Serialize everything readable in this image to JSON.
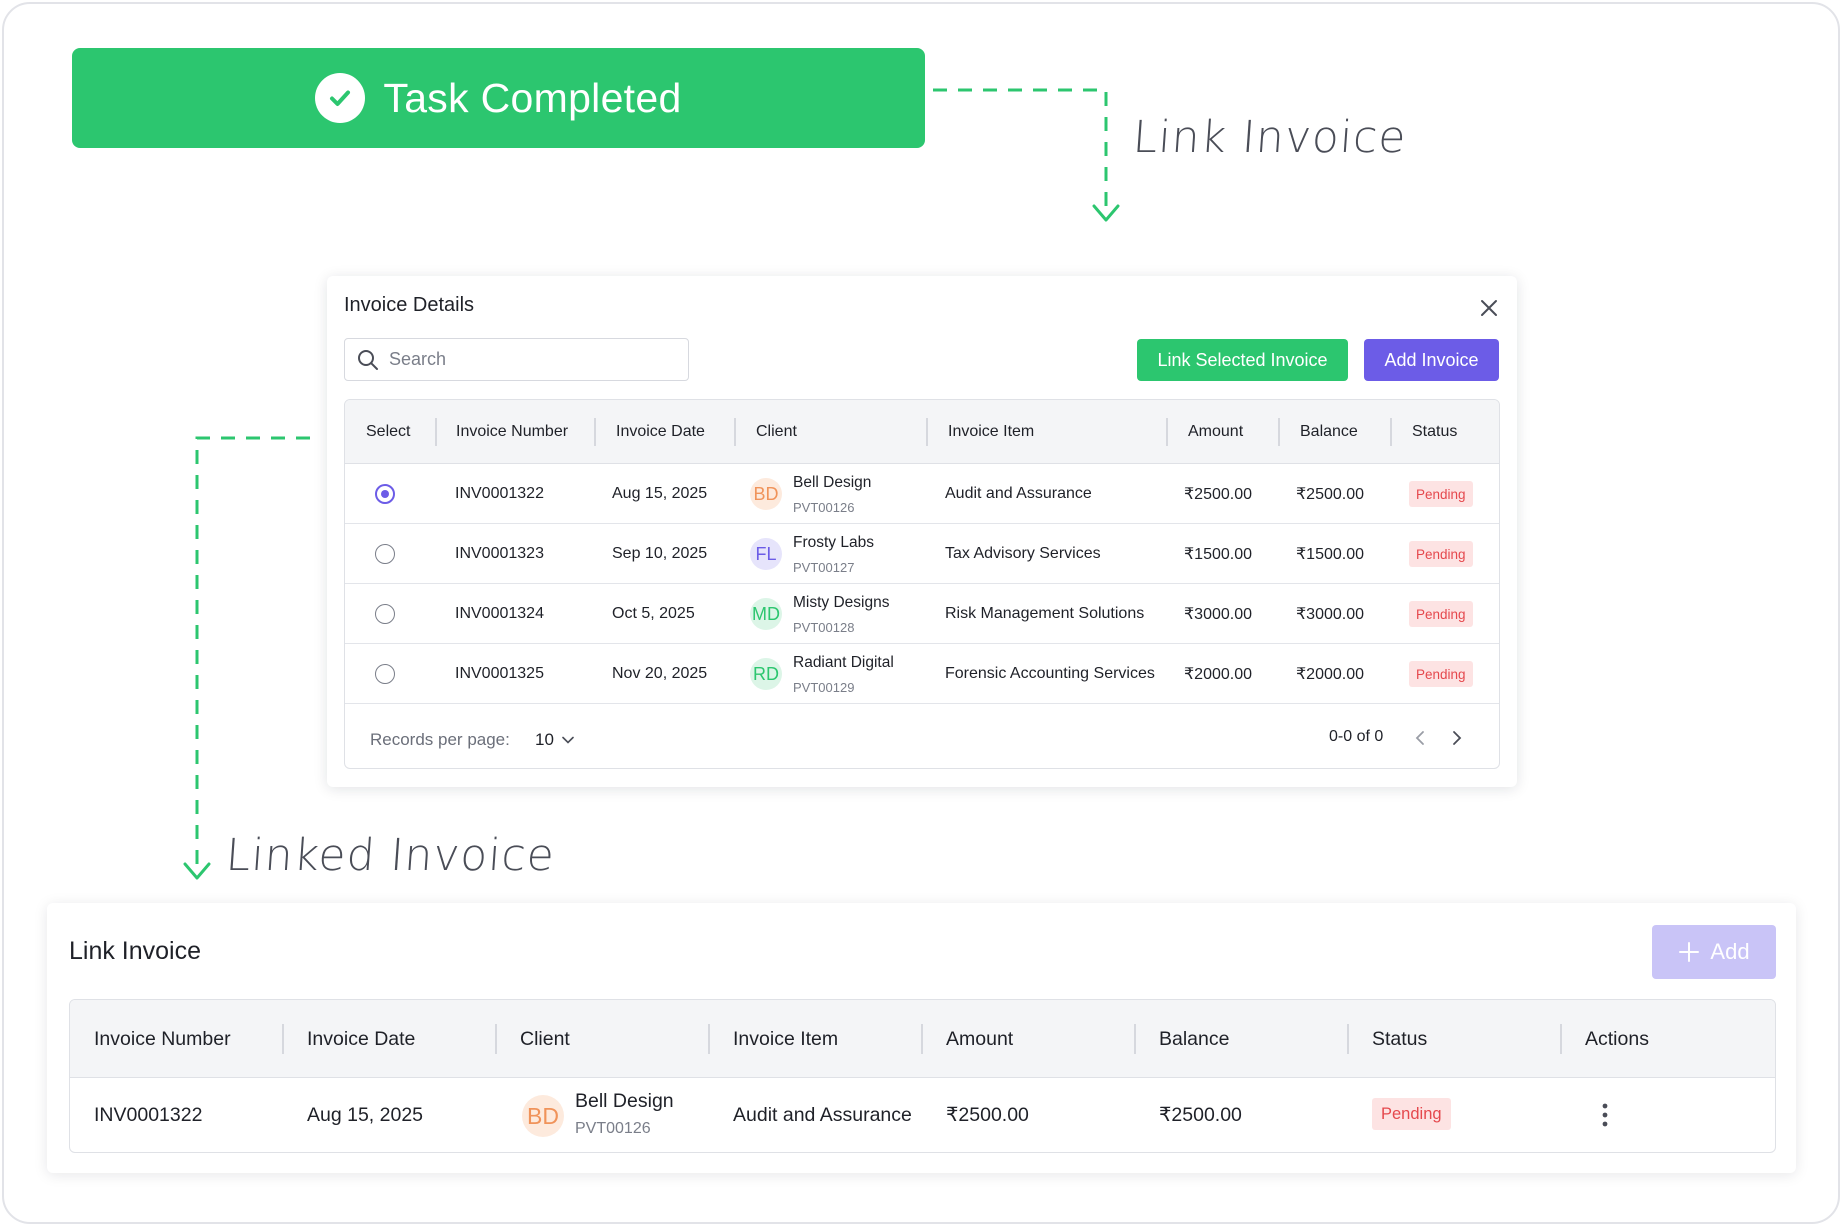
{
  "banner": {
    "title": "Task Completed"
  },
  "annotations": {
    "link_invoice": "Link Invoice",
    "linked_invoice": "Linked Invoice"
  },
  "colors": {
    "green": "#2cc66f",
    "purple": "#6c5ce7",
    "pending_bg": "#fde3e3",
    "pending_text": "#e5484d"
  },
  "modal": {
    "title": "Invoice Details",
    "search_placeholder": "Search",
    "link_selected_label": "Link Selected Invoice",
    "add_invoice_label": "Add Invoice",
    "columns": [
      "Select",
      "Invoice Number",
      "Invoice Date",
      "Client",
      "Invoice Item",
      "Amount",
      "Balance",
      "Status"
    ],
    "rows": [
      {
        "selected": true,
        "number": "INV0001322",
        "date": "Aug 15, 2025",
        "initials": "BD",
        "avatar_bg": "#fdeadd",
        "avatar_fg": "#f0935a",
        "client": "Bell Design",
        "code": "PVT00126",
        "item": "Audit and Assurance",
        "amount": "₹2500.00",
        "balance": "₹2500.00",
        "status": "Pending"
      },
      {
        "selected": false,
        "number": "INV0001323",
        "date": "Sep 10, 2025",
        "initials": "FL",
        "avatar_bg": "#e6e4fb",
        "avatar_fg": "#6c5ce7",
        "client": "Frosty Labs",
        "code": "PVT00127",
        "item": "Tax Advisory Services",
        "amount": "₹1500.00",
        "balance": "₹1500.00",
        "status": "Pending"
      },
      {
        "selected": false,
        "number": "INV0001324",
        "date": "Oct 5, 2025",
        "initials": "MD",
        "avatar_bg": "#dcf5e7",
        "avatar_fg": "#2cc66f",
        "client": "Misty Designs",
        "code": "PVT00128",
        "item": "Risk Management Solutions",
        "amount": "₹3000.00",
        "balance": "₹3000.00",
        "status": "Pending"
      },
      {
        "selected": false,
        "number": "INV0001325",
        "date": "Nov 20, 2025",
        "initials": "RD",
        "avatar_bg": "#dcf5e7",
        "avatar_fg": "#2cc66f",
        "client": "Radiant Digital",
        "code": "PVT00129",
        "item": "Forensic Accounting Services",
        "amount": "₹2000.00",
        "balance": "₹2000.00",
        "status": "Pending"
      }
    ],
    "footer": {
      "records_label": "Records per page:",
      "records_value": "10",
      "range": "0-0 of 0"
    }
  },
  "linked": {
    "title": "Link Invoice",
    "add_label": "Add",
    "columns": [
      "Invoice Number",
      "Invoice Date",
      "Client",
      "Invoice Item",
      "Amount",
      "Balance",
      "Status",
      "Actions"
    ],
    "row": {
      "number": "INV0001322",
      "date": "Aug 15, 2025",
      "initials": "BD",
      "client": "Bell Design",
      "code": "PVT00126",
      "item": "Audit and Assurance",
      "amount": "₹2500.00",
      "balance": "₹2500.00",
      "status": "Pending"
    }
  }
}
